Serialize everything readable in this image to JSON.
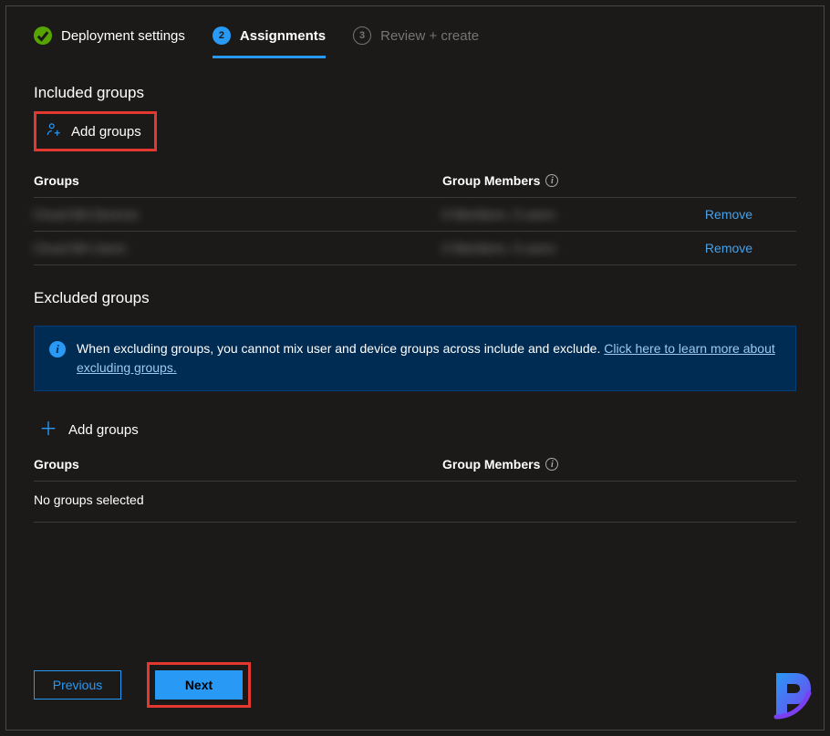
{
  "stepper": {
    "steps": [
      {
        "num": "✓",
        "label": "Deployment settings",
        "state": "completed"
      },
      {
        "num": "2",
        "label": "Assignments",
        "state": "active"
      },
      {
        "num": "3",
        "label": "Review + create",
        "state": "pending"
      }
    ]
  },
  "included": {
    "heading": "Included groups",
    "add_label": "Add groups",
    "columns": {
      "groups": "Groups",
      "members": "Group Members"
    },
    "rows": [
      {
        "group": "Cloud MA Devices",
        "members": "0 Members, 0 users",
        "action": "Remove"
      },
      {
        "group": "Cloud MA Users",
        "members": "0 Members, 0 users",
        "action": "Remove"
      }
    ]
  },
  "excluded": {
    "heading": "Excluded groups",
    "info_text": "When excluding groups, you cannot mix user and device groups across include and exclude. ",
    "info_link": "Click here to learn more about excluding groups.",
    "add_label": "Add groups",
    "columns": {
      "groups": "Groups",
      "members": "Group Members"
    },
    "empty": "No groups selected"
  },
  "footer": {
    "previous": "Previous",
    "next": "Next"
  }
}
